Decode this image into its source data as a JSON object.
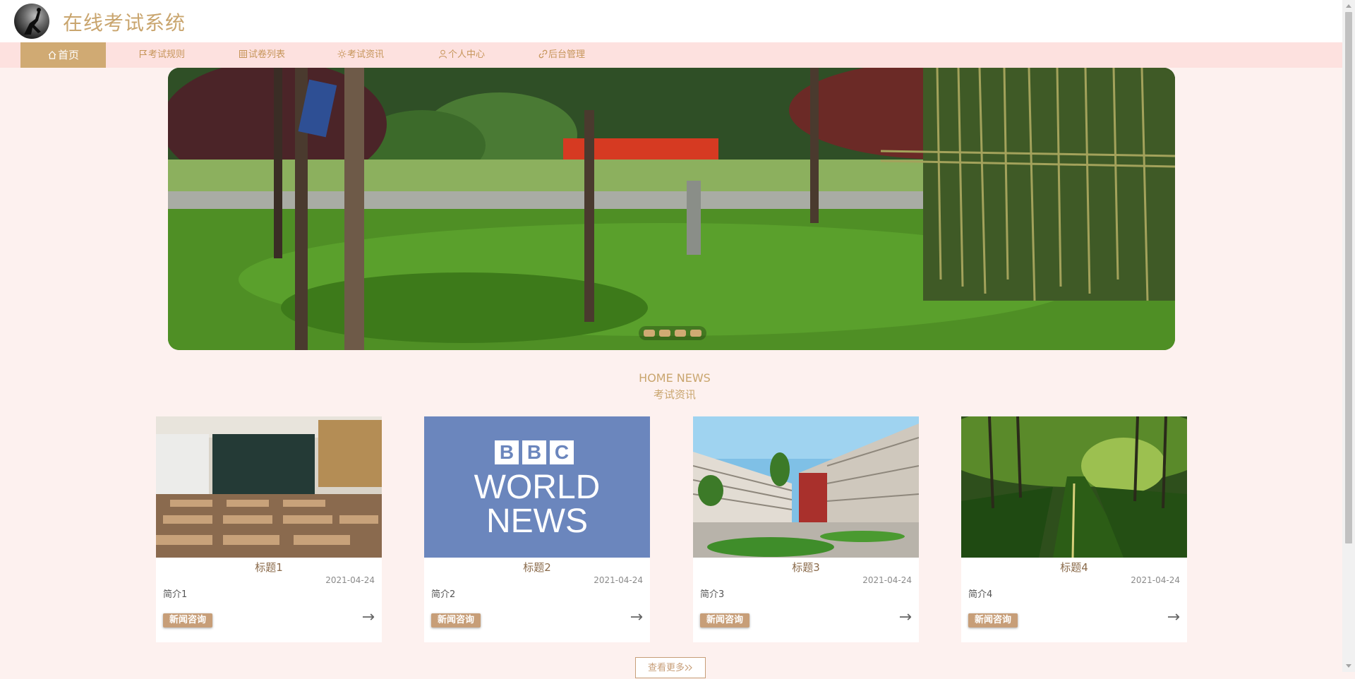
{
  "header": {
    "title": "在线考试系统"
  },
  "nav": {
    "items": [
      {
        "label": "首页",
        "icon": "home-icon",
        "active": true
      },
      {
        "label": "考试规则",
        "icon": "flag-icon"
      },
      {
        "label": "试卷列表",
        "icon": "grid-icon"
      },
      {
        "label": "考试资讯",
        "icon": "sun-icon"
      },
      {
        "label": "个人中心",
        "icon": "user-icon"
      },
      {
        "label": "后台管理",
        "icon": "link-icon"
      }
    ]
  },
  "carousel": {
    "slide_count": 4,
    "active_slide": 1
  },
  "news": {
    "heading_en": "HOME NEWS",
    "heading_cn": "考试资讯",
    "more_label": "查看更多",
    "cards": [
      {
        "title": "标题1",
        "date": "2021-04-24",
        "intro": "简介1",
        "tag": "新闻咨询",
        "arrow": "→"
      },
      {
        "title": "标题2",
        "date": "2021-04-24",
        "intro": "简介2",
        "tag": "新闻咨询",
        "arrow": "→",
        "image_text": {
          "line1": "BBC",
          "line2": "WORLD",
          "line3": "NEWS"
        }
      },
      {
        "title": "标题3",
        "date": "2021-04-24",
        "intro": "简介3",
        "tag": "新闻咨询",
        "arrow": "→"
      },
      {
        "title": "标题4",
        "date": "2021-04-24",
        "intro": "简介4",
        "tag": "新闻咨询",
        "arrow": "→"
      }
    ]
  },
  "colors": {
    "accent": "#d0aa73",
    "nav_bg": "#fde1df",
    "page_bg": "#fdf1ef",
    "tag_bg": "#c79e78"
  }
}
